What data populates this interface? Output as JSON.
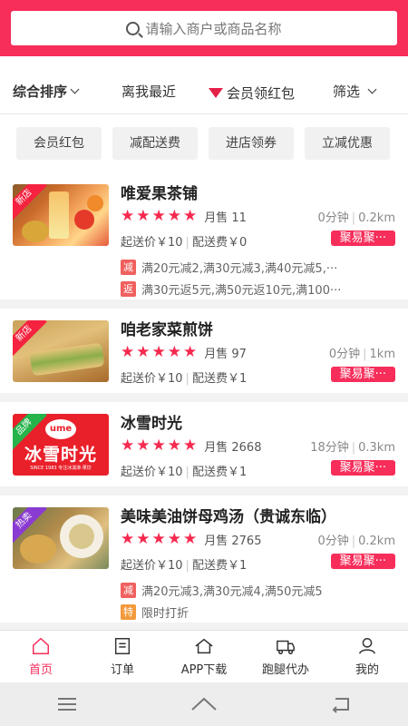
{
  "search": {
    "placeholder": "请输入商户或商品名称"
  },
  "sort": {
    "default": "综合排序",
    "nearest": "离我最近",
    "member": "会员领红包",
    "filter": "筛选"
  },
  "chips": [
    "会员红包",
    "减配送费",
    "进店领券",
    "立减优惠"
  ],
  "shops": [
    {
      "badge": "新店",
      "badge_color": "#f5233f",
      "name": "唯爱果茶铺",
      "rating": 5,
      "sales": "月售 11",
      "time": "0分钟",
      "distance": "0.2km",
      "min_order": "起送价￥10",
      "delivery_fee": "配送费￥0",
      "tag": "聚易聚···",
      "promos": [
        {
          "tag": "减",
          "color": "#f0605e",
          "text": "满20元减2,满30元减3,满40元减5,···"
        },
        {
          "tag": "返",
          "color": "#f0605e",
          "text": "满30元返5元,满50元返10元,满100···"
        }
      ]
    },
    {
      "badge": "新店",
      "badge_color": "#f5233f",
      "name": "咱老家菜煎饼",
      "rating": 5,
      "sales": "月售 97",
      "time": "0分钟",
      "distance": "1km",
      "min_order": "起送价￥10",
      "delivery_fee": "配送费￥1",
      "tag": "聚易聚···",
      "promos": []
    },
    {
      "badge": "品牌",
      "badge_color": "#25b34a",
      "name": "冰雪时光",
      "rating": 5,
      "sales": "月售 2668",
      "time": "18分钟",
      "distance": "0.3km",
      "min_order": "起送价￥10",
      "delivery_fee": "配送费￥1",
      "tag": "聚易聚···",
      "promos": []
    },
    {
      "badge": "热卖",
      "badge_color": "#8a3bd1",
      "name": "美味美油饼母鸡汤（贵诚东临）",
      "rating": 5,
      "sales": "月售 2765",
      "time": "0分钟",
      "distance": "0.2km",
      "min_order": "起送价￥10",
      "delivery_fee": "配送费￥1",
      "tag": "聚易聚···",
      "promos": [
        {
          "tag": "减",
          "color": "#f0605e",
          "text": "满20元减3,满30元减4,满50元减5"
        },
        {
          "tag": "特",
          "color": "#f39a3c",
          "text": "限时打折"
        }
      ]
    }
  ],
  "bingxue_logo": {
    "text": "冰雪时光",
    "sub": "SINCE 1983 专注冰淇淋·果饮"
  },
  "tabs": [
    {
      "label": "首页",
      "icon": "home-icon",
      "active": true
    },
    {
      "label": "订单",
      "icon": "order-icon",
      "active": false
    },
    {
      "label": "APP下载",
      "icon": "download-icon",
      "active": false
    },
    {
      "label": "跑腿代办",
      "icon": "truck-icon",
      "active": false
    },
    {
      "label": "我的",
      "icon": "user-icon",
      "active": false
    }
  ],
  "colors": {
    "brand": "#f72d5a",
    "star": "#f7294f"
  }
}
